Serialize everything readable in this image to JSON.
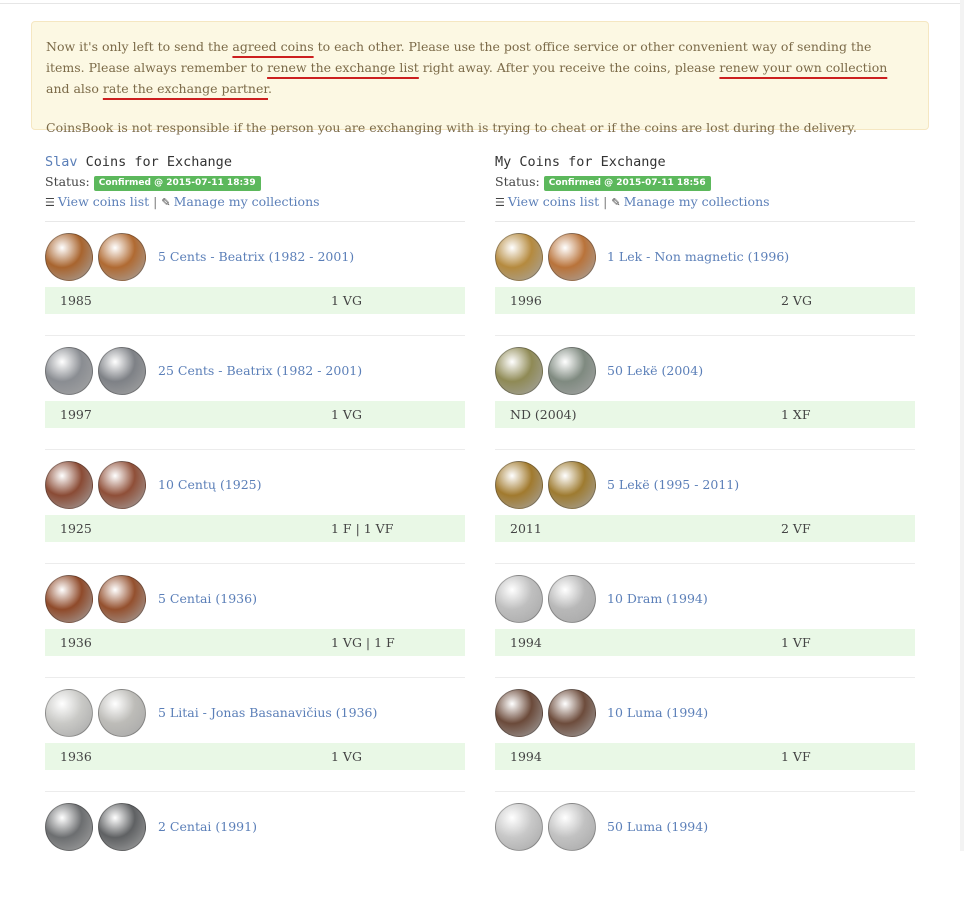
{
  "notice": {
    "p1": {
      "t1": "Now it's only left to send the ",
      "l1": "agreed coins",
      "t2": " to each other. Please use the post office service or other convenient way of sending the items. Please always remember to ",
      "l2": "renew the exchange list",
      "t3": " right away. After you receive the coins, please ",
      "l3": "renew your own collection",
      "t4": " and also ",
      "l4": "rate the exchange partner",
      "t5": "."
    },
    "p2": "CoinsBook is not responsible if the person you are exchanging with is trying to cheat or if the coins are lost during the delivery."
  },
  "left": {
    "owner": "Slav",
    "title_rest": " Coins for Exchange",
    "status_label": "Status:",
    "status_badge": "Confirmed @ 2015-07-11 18:39",
    "view_link": "View coins list",
    "separator": "|",
    "manage_link": "Manage my collections",
    "items": [
      {
        "name": "5 Cents - Beatrix (1982 - 2001)",
        "year": "1985",
        "cond": "1 VG",
        "c1": "#a8642e",
        "c2": "#b06a32"
      },
      {
        "name": "25 Cents - Beatrix (1982 - 2001)",
        "year": "1997",
        "cond": "1 VG",
        "c1": "#8a8d92",
        "c2": "#7e8186"
      },
      {
        "name": "10 Centų (1925)",
        "year": "1925",
        "cond": "1 F | 1 VF",
        "c1": "#8a4b35",
        "c2": "#8f4f38"
      },
      {
        "name": "5 Centai (1936)",
        "year": "1936",
        "cond": "1 VG | 1 F",
        "c1": "#8f4a2a",
        "c2": "#94502e"
      },
      {
        "name": "5 Litai - Jonas Basanavičius (1936)",
        "year": "1936",
        "cond": "1 VG",
        "c1": "#c9c9c6",
        "c2": "#bdbcb8"
      },
      {
        "name": "2 Centai (1991)",
        "year": "",
        "cond": "",
        "c1": "#6c6e70",
        "c2": "#5f6163"
      }
    ]
  },
  "right": {
    "title": "My Coins for Exchange",
    "status_label": "Status:",
    "status_badge": "Confirmed @ 2015-07-11 18:56",
    "view_link": "View coins list",
    "separator": "|",
    "manage_link": "Manage my collections",
    "items": [
      {
        "name": "1 Lek - Non magnetic (1996)",
        "year": "1996",
        "cond": "2 VG",
        "c1": "#b58a3e",
        "c2": "#b9733a"
      },
      {
        "name": "50 Lekë (2004)",
        "year": "ND (2004)",
        "cond": "1 XF",
        "c1": "#8f8a55",
        "c2": "#7f8a80"
      },
      {
        "name": "5 Lekë (1995 - 2011)",
        "year": "2011",
        "cond": "2 VF",
        "c1": "#a17a2e",
        "c2": "#9e7b30"
      },
      {
        "name": "10 Dram (1994)",
        "year": "1994",
        "cond": "1 VF",
        "c1": "#bfbfbf",
        "c2": "#b8b8b8"
      },
      {
        "name": "10 Luma (1994)",
        "year": "1994",
        "cond": "1 VF",
        "c1": "#6b4a3a",
        "c2": "#6d4c3c"
      },
      {
        "name": "50 Luma (1994)",
        "year": "",
        "cond": "",
        "c1": "#c8c8c8",
        "c2": "#c2c2c2"
      }
    ]
  },
  "icons": {
    "list": "list-icon",
    "edit": "edit-icon"
  }
}
